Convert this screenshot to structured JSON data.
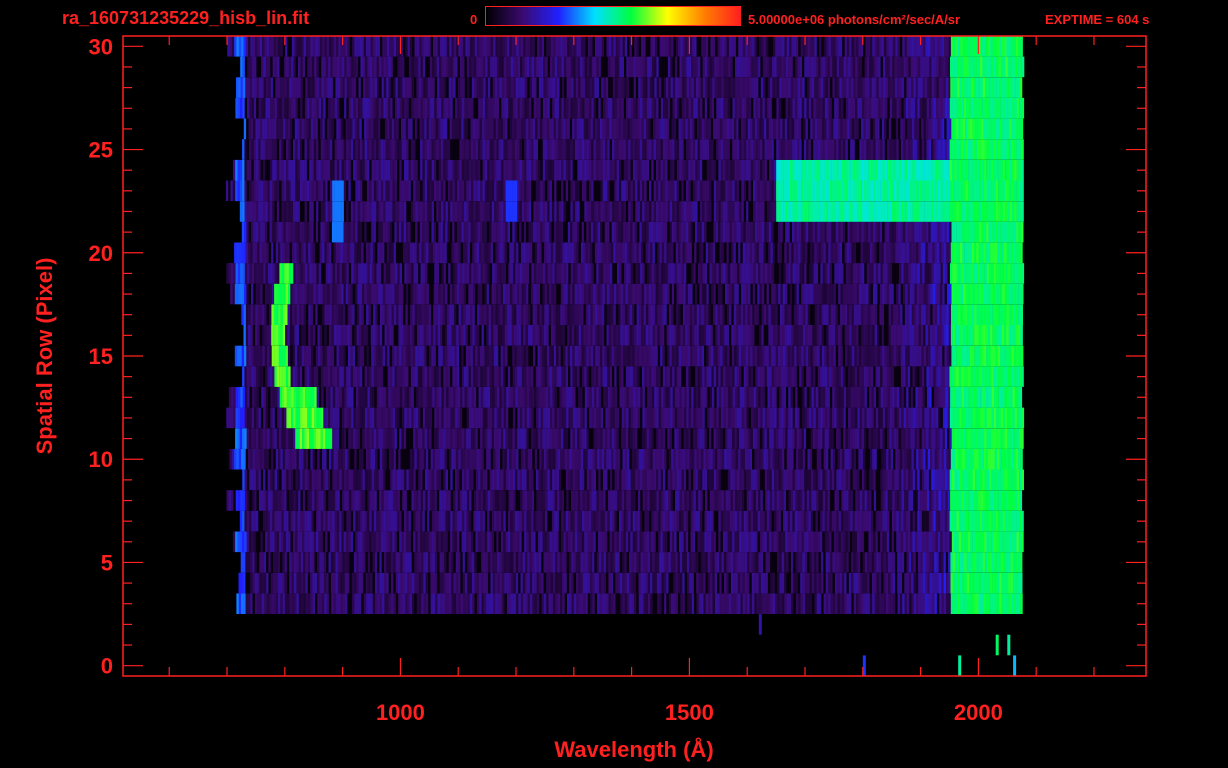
{
  "header": {
    "file_name": "ra_160731235229_hisb_lin.fit",
    "colorbar_min": "0",
    "colorbar_max": "5.00000e+06 photons/cm²/sec/A/sr",
    "exptime": "EXPTIME = 604 s"
  },
  "colors": {
    "axis": "#ff2020",
    "background": "#000000",
    "colormap": [
      "#000000",
      "#3a0a6e",
      "#2020ff",
      "#00e0ff",
      "#00ff40",
      "#ffff00",
      "#ff8000",
      "#ff2020"
    ]
  },
  "chart_data": {
    "type": "heatmap",
    "xlabel": "Wavelength (Å)",
    "ylabel": "Spatial Row (Pixel)",
    "xlim": [
      520,
      2290
    ],
    "ylim": [
      -0.5,
      30.5
    ],
    "x_ticks": [
      1000,
      1500,
      2000
    ],
    "x_tick_labels": [
      "1000",
      "1500",
      "2000"
    ],
    "y_ticks": [
      0,
      5,
      10,
      15,
      20,
      25,
      30
    ],
    "y_tick_labels": [
      "0",
      "5",
      "10",
      "15",
      "20",
      "25",
      "30"
    ],
    "value_range": [
      0,
      5000000
    ],
    "value_units": "photons/cm²/sec/A/sr",
    "data_x_range": [
      690,
      2075
    ],
    "data_row_range": [
      3,
      30
    ],
    "features": [
      {
        "name_desc": "curved bright arc",
        "rows": [
          11,
          19
        ],
        "wavelength": [
          780,
          870
        ],
        "level": 0.55
      },
      {
        "name_desc": "horizontal band",
        "rows": [
          22,
          24
        ],
        "wavelength": [
          1650,
          2060
        ],
        "level": 0.45
      },
      {
        "name_desc": "long wavelength edge",
        "rows": [
          3,
          30
        ],
        "wavelength": [
          1950,
          2075
        ],
        "level": 0.5
      }
    ]
  }
}
